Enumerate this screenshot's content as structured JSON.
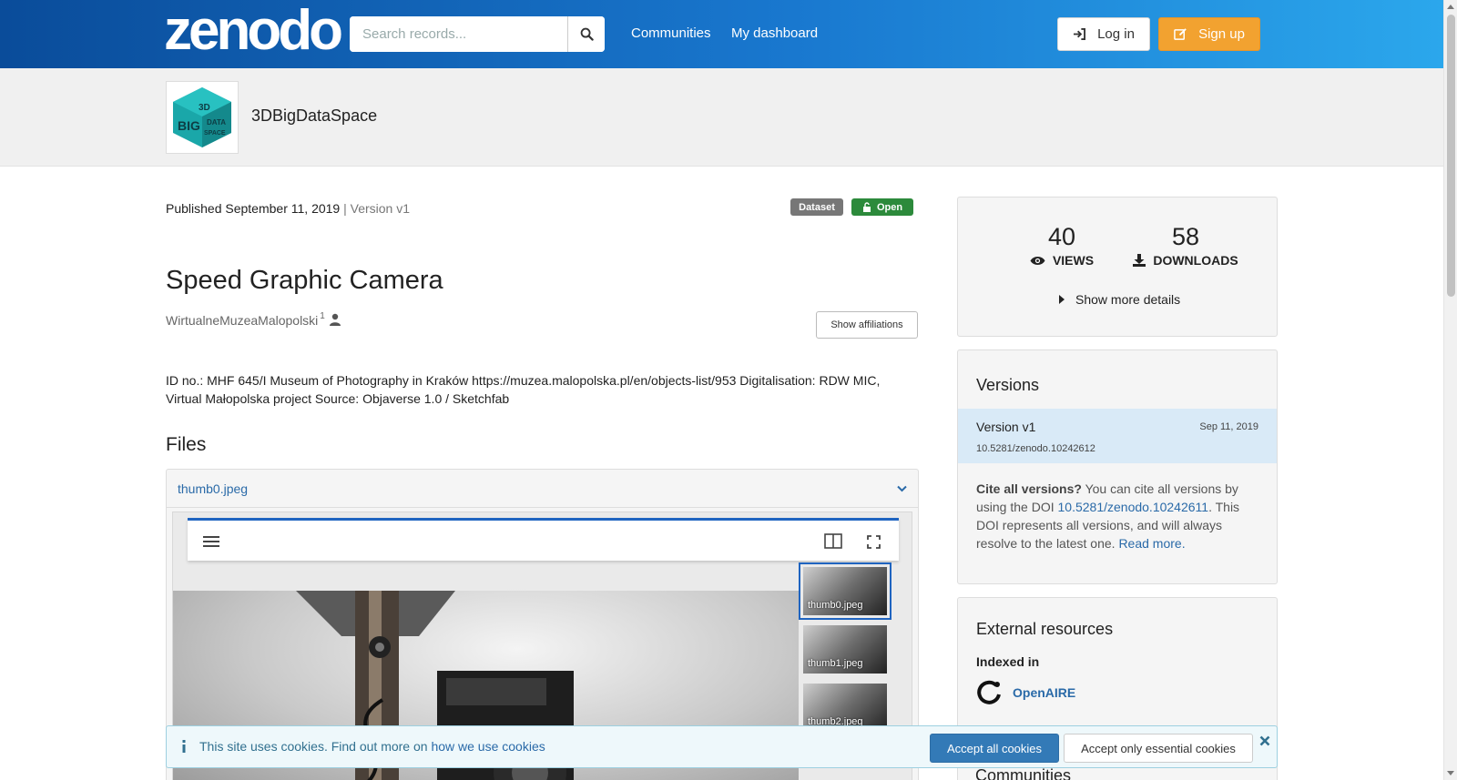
{
  "header": {
    "logo_text": "zenodo",
    "search_placeholder": "Search records...",
    "nav": [
      "Communities",
      "My dashboard"
    ],
    "login_label": "Log in",
    "signup_label": "Sign up"
  },
  "community": {
    "name": "3DBigDataSpace",
    "logo_words": [
      "3D",
      "BIG",
      "DATA",
      "SPACE"
    ]
  },
  "record": {
    "published": "Published September 11, 2019",
    "version": "| Version v1",
    "badge_type": "Dataset",
    "badge_access": "Open",
    "title": "Speed Graphic Camera",
    "creator": "WirtualneMuzeaMalopolski",
    "creator_sup": "1",
    "show_affiliations": "Show affiliations",
    "description": "ID no.: MHF 645/I Museum of Photography in Kraków https://muzea.malopolska.pl/en/objects-list/953 Digitalisation: RDW MIC, Virtual Małopolska project Source: Objaverse 1.0 / Sketchfab"
  },
  "files": {
    "heading": "Files",
    "current_file": "thumb0.jpeg",
    "thumbnails": [
      "thumb0.jpeg",
      "thumb1.jpeg",
      "thumb2.jpeg"
    ]
  },
  "stats": {
    "views": "40",
    "views_label": "VIEWS",
    "downloads": "58",
    "downloads_label": "DOWNLOADS",
    "more_details": "Show more details"
  },
  "versions": {
    "heading": "Versions",
    "items": [
      {
        "name": "Version v1",
        "date": "Sep 11, 2019",
        "doi": "10.5281/zenodo.10242612"
      }
    ],
    "cite_bold": "Cite all versions?",
    "cite_text1": "You can cite all versions by using the DOI",
    "cite_doi": "10.5281/zenodo.10242611",
    "cite_text2": ". This DOI represents all versions, and will always resolve to the latest one.",
    "read_more": "Read more."
  },
  "external": {
    "heading": "External resources",
    "indexed_in": "Indexed in",
    "openaire": "OpenAIRE"
  },
  "communities_heading": "Communities",
  "cookie": {
    "text": "This site uses cookies. Find out more on",
    "link": "how we use cookies",
    "accept_all": "Accept all cookies",
    "accept_essential": "Accept only essential cookies"
  },
  "colors": {
    "header_start": "#0a4c9a",
    "header_end": "#2ba7ec",
    "signup": "#f2a230",
    "open_badge": "#2c8a3b",
    "link": "#2a6aa8",
    "version_highlight": "#d9eaf7"
  },
  "icons": [
    "search-icon",
    "sign-in-icon",
    "edit-icon",
    "lock-open-icon",
    "user-icon",
    "chevron-down-icon",
    "menu-icon",
    "book-icon",
    "fullscreen-icon",
    "eye-icon",
    "download-icon",
    "caret-right-icon",
    "openaire-icon",
    "info-icon",
    "close-icon"
  ]
}
